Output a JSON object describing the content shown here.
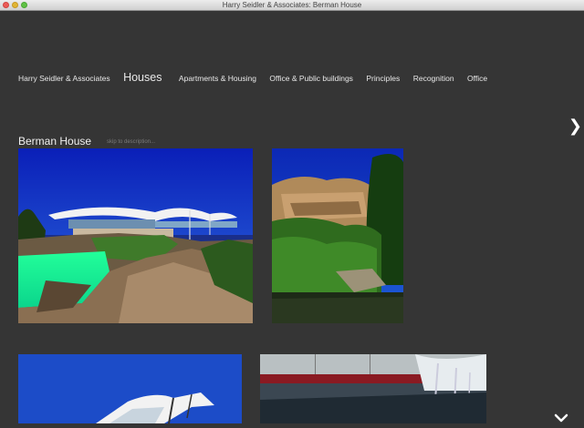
{
  "window": {
    "title": "Harry Seidler & Associates: Berman House"
  },
  "nav": {
    "items": [
      {
        "label": "Harry Seidler & Associates",
        "active": false
      },
      {
        "label": "Houses",
        "active": true
      },
      {
        "label": "Apartments & Housing",
        "active": false
      },
      {
        "label": "Office & Public buildings",
        "active": false
      },
      {
        "label": "Principles",
        "active": false
      },
      {
        "label": "Recognition",
        "active": false
      },
      {
        "label": "Office",
        "active": false
      }
    ]
  },
  "project": {
    "title": "Berman House",
    "skip_link": "skip to description..."
  },
  "icons": {
    "next": "chevron-right-icon",
    "scroll_down": "chevron-down-icon"
  },
  "colors": {
    "background": "#353535",
    "text": "#e6e6e6",
    "skip_link": "#7a7a7a"
  }
}
